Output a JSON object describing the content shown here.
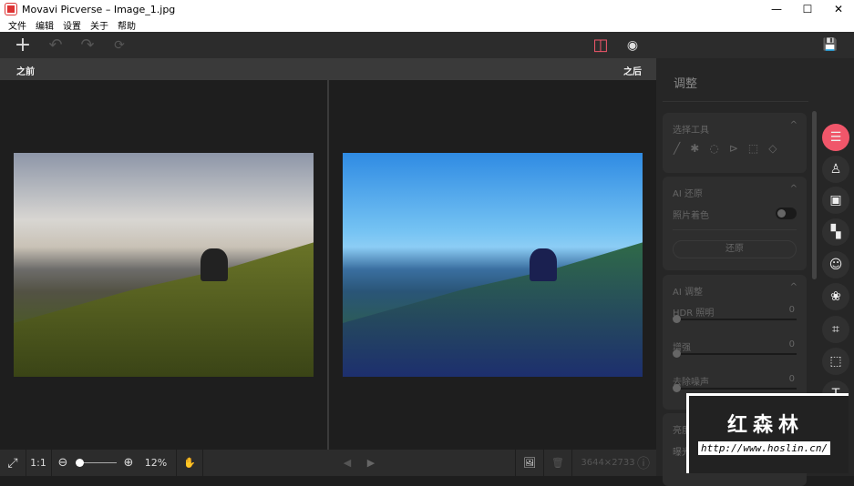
{
  "window": {
    "title": "Movavi Picverse – Image_1.jpg",
    "min": "—",
    "max": "☐",
    "close": "✕"
  },
  "menu": [
    "文件",
    "编辑",
    "设置",
    "关于",
    "帮助"
  ],
  "toolbar": {
    "add": "+",
    "undo": "↶",
    "redo": "↷",
    "reset": "⟳",
    "compare": "◫",
    "preview": "◉",
    "save": "💾"
  },
  "compare": {
    "before": "之前",
    "after": "之后"
  },
  "bottom": {
    "fit": "⤢",
    "one_to_one": "1:1",
    "zoom_out": "⊖",
    "zoom_in": "⊕",
    "zoom": "12%",
    "zoom_level": 12,
    "hand": "✋",
    "prev": "◀",
    "next": "▶",
    "image": "🖼",
    "trash": "🗑",
    "dimensions": "3644×2733",
    "info": "ⓘ"
  },
  "panel": {
    "title": "调整",
    "select_tools": {
      "title": "选择工具",
      "chevron": "^",
      "icons": [
        "brush",
        "magic-wand",
        "lasso",
        "polygon-lasso",
        "rect-select",
        "eraser"
      ]
    },
    "ai_restore": {
      "title": "AI 还原",
      "chevron": "^",
      "colorize": "照片着色",
      "restore_btn": "还原"
    },
    "ai_adjust": {
      "title": "AI 调整",
      "chevron": "^",
      "sliders": [
        {
          "label": "HDR 照明",
          "value": "0"
        },
        {
          "label": "增强",
          "value": "0"
        },
        {
          "label": "去除噪声",
          "value": "0"
        }
      ]
    },
    "brightness": {
      "title": "亮度",
      "sub": "曝光"
    }
  },
  "rail": [
    "adjust",
    "stamp",
    "background",
    "mosaic",
    "face",
    "color",
    "crop",
    "object-removal",
    "text"
  ],
  "watermark": {
    "name": "红森林",
    "url": "http://www.hoslin.cn/"
  },
  "colors": {
    "accent": "#f0566a"
  }
}
